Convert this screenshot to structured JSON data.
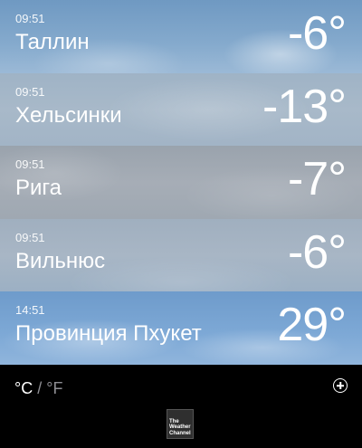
{
  "cities": [
    {
      "time": "09:51",
      "name": "Таллин",
      "temp": "-6°"
    },
    {
      "time": "09:51",
      "name": "Хельсинки",
      "temp": "-13°"
    },
    {
      "time": "09:51",
      "name": "Рига",
      "temp": "-7°"
    },
    {
      "time": "09:51",
      "name": "Вильнюс",
      "temp": "-6°"
    },
    {
      "time": "14:51",
      "name": "Провинция Пхукет",
      "temp": "29°"
    }
  ],
  "footer": {
    "unit_c": "°C",
    "unit_sep": "/",
    "unit_f": "°F",
    "logo_lines": [
      "The",
      "Weather",
      "Channel"
    ]
  }
}
